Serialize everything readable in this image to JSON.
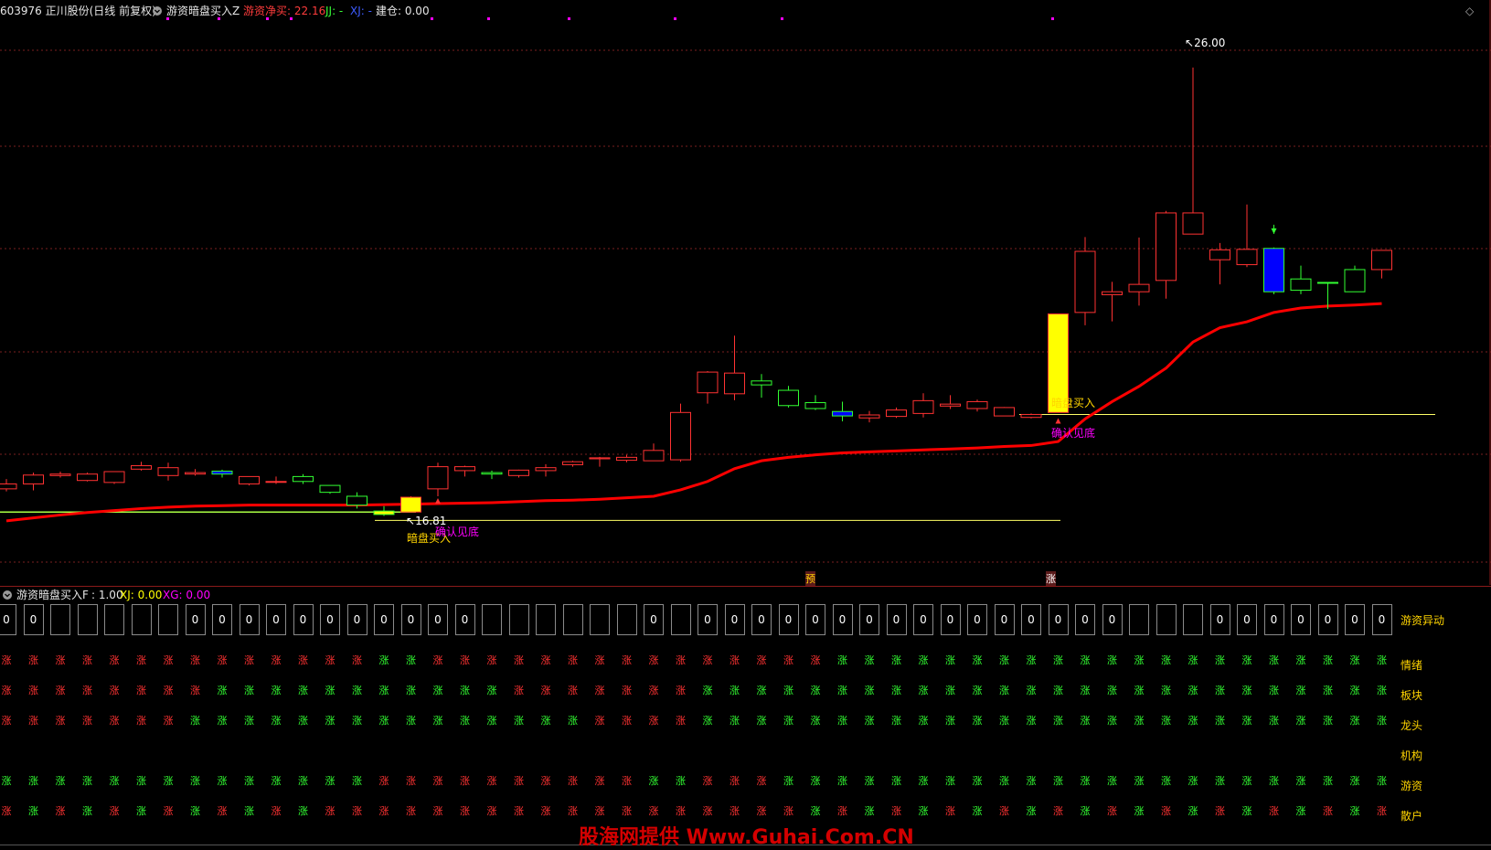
{
  "header": {
    "stock": "603976 正川股份(日线 前复权)",
    "indicator": "游资暗盘买入Z",
    "net_label": "游资净买: 22.16",
    "jj": "JJ: -",
    "xj": "XJ: -",
    "jc": "建仓: 0.00"
  },
  "colors": {
    "up": "#ff3232",
    "down": "#32ff32",
    "ma": "#ff0000",
    "yellow": "#ffff00",
    "blue": "#0000ff",
    "magenta": "#ff00ff",
    "label_yellow": "#ffd400"
  },
  "annotations": {
    "high_label": "26.00",
    "low_label": "16.81",
    "buy_signal_1": "暗盘买入",
    "confirm_1": "确认见底",
    "buy_signal_2": "暗盘买入",
    "confirm_2": "确认见底",
    "marker_yu": "预",
    "marker_zhang": "涨"
  },
  "chart_data": {
    "type": "candlestick",
    "y_axis_range": [
      15.5,
      27.0
    ],
    "high_price": 26.0,
    "low_price": 16.81,
    "candles": [
      {
        "o": 17.45,
        "h": 17.65,
        "l": 17.4,
        "c": 17.55
      },
      {
        "o": 17.55,
        "h": 17.78,
        "l": 17.42,
        "c": 17.73
      },
      {
        "o": 17.72,
        "h": 17.8,
        "l": 17.68,
        "c": 17.75
      },
      {
        "o": 17.62,
        "h": 17.78,
        "l": 17.6,
        "c": 17.75
      },
      {
        "o": 17.58,
        "h": 17.8,
        "l": 17.55,
        "c": 17.8
      },
      {
        "o": 17.85,
        "h": 18.0,
        "l": 17.82,
        "c": 17.92
      },
      {
        "o": 17.72,
        "h": 17.98,
        "l": 17.62,
        "c": 17.88
      },
      {
        "o": 17.75,
        "h": 17.85,
        "l": 17.72,
        "c": 17.78
      },
      {
        "o": 17.75,
        "h": 17.84,
        "l": 17.68,
        "c": 17.81
      },
      {
        "o": 17.55,
        "h": 17.7,
        "l": 17.52,
        "c": 17.7
      },
      {
        "o": 17.6,
        "h": 17.7,
        "l": 17.55,
        "c": 17.6
      },
      {
        "o": 17.7,
        "h": 17.75,
        "l": 17.55,
        "c": 17.6
      },
      {
        "o": 17.52,
        "h": 17.52,
        "l": 17.35,
        "c": 17.38
      },
      {
        "o": 17.3,
        "h": 17.38,
        "l": 17.05,
        "c": 17.12
      },
      {
        "o": 17.0,
        "h": 17.1,
        "l": 16.9,
        "c": 16.93
      },
      {
        "o": 16.98,
        "h": 17.3,
        "l": 16.98,
        "c": 17.28
      },
      {
        "o": 17.45,
        "h": 17.98,
        "l": 17.3,
        "c": 17.9
      },
      {
        "o": 17.82,
        "h": 17.92,
        "l": 17.7,
        "c": 17.9
      },
      {
        "o": 17.78,
        "h": 17.82,
        "l": 17.65,
        "c": 17.75
      },
      {
        "o": 17.72,
        "h": 17.84,
        "l": 17.68,
        "c": 17.83
      },
      {
        "o": 17.82,
        "h": 17.95,
        "l": 17.7,
        "c": 17.88
      },
      {
        "o": 17.94,
        "h": 18.02,
        "l": 17.9,
        "c": 18.0
      },
      {
        "o": 18.06,
        "h": 18.1,
        "l": 17.9,
        "c": 18.08
      },
      {
        "o": 18.03,
        "h": 18.14,
        "l": 17.99,
        "c": 18.09
      },
      {
        "o": 18.02,
        "h": 18.37,
        "l": 18.02,
        "c": 18.23
      },
      {
        "o": 18.04,
        "h": 19.18,
        "l": 18.0,
        "c": 19.0
      },
      {
        "o": 19.4,
        "h": 19.84,
        "l": 19.18,
        "c": 19.82
      },
      {
        "o": 19.38,
        "h": 20.56,
        "l": 19.25,
        "c": 19.8
      },
      {
        "o": 19.64,
        "h": 19.78,
        "l": 19.3,
        "c": 19.56
      },
      {
        "o": 19.45,
        "h": 19.54,
        "l": 19.1,
        "c": 19.14
      },
      {
        "o": 19.2,
        "h": 19.35,
        "l": 19.05,
        "c": 19.08
      },
      {
        "o": 19.02,
        "h": 19.22,
        "l": 18.82,
        "c": 18.93
      },
      {
        "o": 18.89,
        "h": 19.03,
        "l": 18.8,
        "c": 18.95
      },
      {
        "o": 18.92,
        "h": 19.1,
        "l": 18.89,
        "c": 19.05
      },
      {
        "o": 18.98,
        "h": 19.39,
        "l": 18.9,
        "c": 19.24
      },
      {
        "o": 19.13,
        "h": 19.35,
        "l": 19.07,
        "c": 19.17
      },
      {
        "o": 19.08,
        "h": 19.26,
        "l": 19.02,
        "c": 19.22
      },
      {
        "o": 18.93,
        "h": 19.11,
        "l": 18.93,
        "c": 19.1
      },
      {
        "o": 18.9,
        "h": 18.98,
        "l": 18.88,
        "c": 18.96
      },
      {
        "o": 19.0,
        "h": 21.0,
        "l": 19.0,
        "c": 21.0
      },
      {
        "o": 21.03,
        "h": 22.56,
        "l": 20.77,
        "c": 22.27
      },
      {
        "o": 21.39,
        "h": 21.65,
        "l": 20.85,
        "c": 21.45
      },
      {
        "o": 21.45,
        "h": 22.55,
        "l": 21.17,
        "c": 21.6
      },
      {
        "o": 21.68,
        "h": 23.09,
        "l": 21.31,
        "c": 23.05
      },
      {
        "o": 22.62,
        "h": 26.0,
        "l": 22.62,
        "c": 23.05
      },
      {
        "o": 22.1,
        "h": 22.44,
        "l": 21.6,
        "c": 22.3
      },
      {
        "o": 22.0,
        "h": 23.22,
        "l": 21.95,
        "c": 22.31
      },
      {
        "o": 21.45,
        "h": 22.35,
        "l": 21.4,
        "c": 22.33
      },
      {
        "o": 21.71,
        "h": 21.98,
        "l": 21.4,
        "c": 21.48
      },
      {
        "o": 21.64,
        "h": 21.64,
        "l": 21.1,
        "c": 21.63
      },
      {
        "o": 21.9,
        "h": 21.98,
        "l": 21.58,
        "c": 21.45
      },
      {
        "o": 21.9,
        "h": 22.25,
        "l": 21.72,
        "c": 22.29
      }
    ],
    "ma_line": [
      16.8,
      16.86,
      16.92,
      16.97,
      17.01,
      17.05,
      17.08,
      17.1,
      17.11,
      17.12,
      17.12,
      17.12,
      17.12,
      17.12,
      17.13,
      17.14,
      17.15,
      17.16,
      17.17,
      17.19,
      17.21,
      17.22,
      17.24,
      17.27,
      17.3,
      17.43,
      17.6,
      17.86,
      18.02,
      18.09,
      18.14,
      18.18,
      18.2,
      18.22,
      18.24,
      18.26,
      18.28,
      18.31,
      18.33,
      18.41,
      18.87,
      19.22,
      19.53,
      19.9,
      20.43,
      20.72,
      20.84,
      21.03,
      21.12,
      21.16,
      21.18,
      21.21
    ]
  },
  "lower_panel": {
    "title": "游资暗盘买入F",
    "value": ": 1.00",
    "xj_label": "XJ: 0.00",
    "xg_label": "XG: 0.00",
    "box_value": "0",
    "char": "涨",
    "row_labels": [
      "游资异动",
      "情绪",
      "板块",
      "龙头",
      "机构",
      "游资",
      "散户"
    ]
  },
  "watermark": "股海网提供 Www.Guhai.Com.CN"
}
